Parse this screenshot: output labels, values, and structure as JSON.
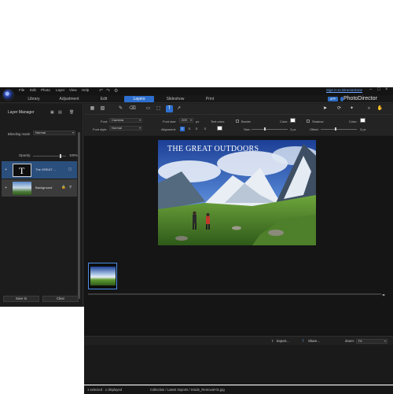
{
  "menu": [
    "File",
    "Edit",
    "Photo",
    "Layer",
    "View",
    "Help"
  ],
  "signin": "Sign in to DirectorZone",
  "tabs": {
    "library": "Library",
    "adjustment": "Adjustment",
    "edit": "Edit",
    "layers": "Layers",
    "slideshow": "Slideshow",
    "print": "Print"
  },
  "brand": {
    "badge": "APP",
    "name": "PhotoDirector"
  },
  "layer_manager": {
    "title": "Layer Manager",
    "blending_label": "Blending mode:",
    "blending_value": "Normal",
    "opacity_label": "Opacity:",
    "opacity_value": "100%",
    "opacity_fraction": 1.0,
    "layers": [
      {
        "name": "The GREAT ..."
      },
      {
        "name": "Background"
      }
    ],
    "save_button": "Save to",
    "clear_button": "Clear"
  },
  "text_props": {
    "font_label": "Font:",
    "font_value": "Cambria",
    "font_size_label": "Font size:",
    "font_size_value": "209",
    "font_size_unit": "px",
    "text_color_label": "Text color:",
    "border_label": "Border",
    "shadow_label": "Shadow",
    "color_label": "Color:",
    "font_style_label": "Font style:",
    "font_style_value": "Normal",
    "alignment_label": "Alignment:",
    "size_label": "Size:",
    "size_value": "3 px",
    "offset_label": "Offset:",
    "offset_value": "3 px"
  },
  "canvas": {
    "overlay_text": "THE GREAT OUTDOORS"
  },
  "share": {
    "export": "Export...",
    "share": "Share...",
    "zoom_label": "Zoom:",
    "zoom_value": "Fit"
  },
  "status": {
    "selection": "1 selected  ·  1 displayed",
    "path": "Collection / Latest Imports / Inside_Removal-01.jpg"
  },
  "colors": {
    "accent": "#2d6fcf",
    "background": "#1f1f1f",
    "panel": "#1c1c1c",
    "selected_row": "#2b4f7d"
  }
}
